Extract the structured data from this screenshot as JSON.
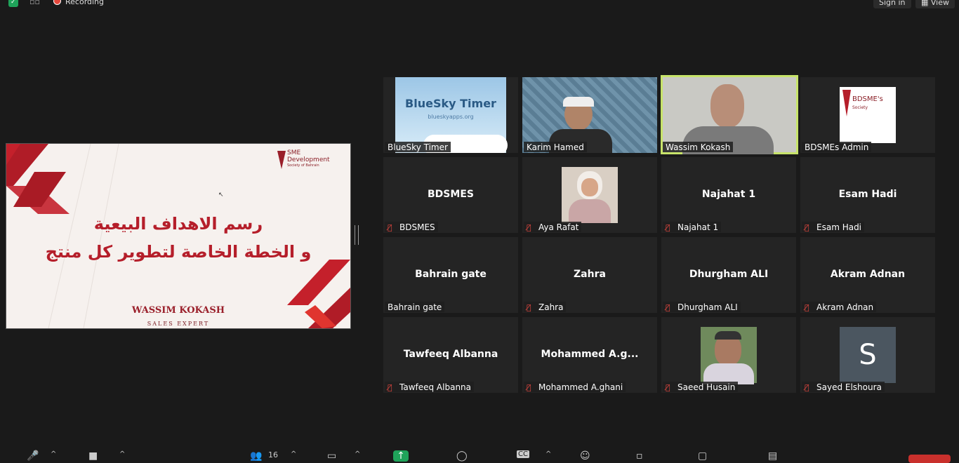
{
  "topbar": {
    "recording_label": "Recording",
    "sign_in": "Sign in",
    "view": "View"
  },
  "slide": {
    "logo_line1": "SME",
    "logo_line2": "Development",
    "logo_line3": "Society of Bahrain",
    "title_line1": "رسم الاهداف البيعية",
    "title_line2": "و الخطة الخاصة لتطوير كل منتج",
    "speaker": "WASSIM KOKASH",
    "role": "SALES EXPERT"
  },
  "tiles": [
    {
      "label": "BlueSky Timer",
      "center": "",
      "muted": false,
      "image_text": "BlueSky Timer",
      "image_sub": "blueskyapps.org"
    },
    {
      "label": "Karim Hamed",
      "center": "",
      "muted": false
    },
    {
      "label": "Wassim Kokash",
      "center": "",
      "muted": false,
      "speaking": true
    },
    {
      "label": "BDSMEs Admin",
      "center": "",
      "muted": false,
      "image_text": "BDSME's",
      "image_sub": "Society"
    },
    {
      "label": "BDSMES",
      "center": "BDSMES",
      "muted": true
    },
    {
      "label": "Aya Rafat",
      "center": "",
      "muted": true
    },
    {
      "label": "Najahat 1",
      "center": "Najahat 1",
      "muted": true
    },
    {
      "label": "Esam Hadi",
      "center": "Esam Hadi",
      "muted": true
    },
    {
      "label": "Bahrain gate",
      "center": "Bahrain gate",
      "muted": false
    },
    {
      "label": "Zahra",
      "center": "Zahra",
      "muted": true
    },
    {
      "label": "Dhurgham ALI",
      "center": "Dhurgham ALI",
      "muted": true
    },
    {
      "label": "Akram Adnan",
      "center": "Akram Adnan",
      "muted": true
    },
    {
      "label": "Tawfeeq Albanna",
      "center": "Tawfeeq Albanna",
      "muted": true
    },
    {
      "label": "Mohammed A.ghani",
      "center": "Mohammed  A.g...",
      "muted": true
    },
    {
      "label": "Saeed Husain",
      "center": "",
      "muted": true
    },
    {
      "label": "Sayed Elshoura",
      "center": "",
      "muted": true,
      "avatar_letter": "S"
    }
  ],
  "toolbar": {
    "participants_count": "16"
  },
  "colors": {
    "background": "#1a1a1a",
    "tile": "#242424",
    "speaker_outline": "#c7e36a",
    "mute_red": "#e0463f",
    "brand_red": "#b51e2a"
  }
}
